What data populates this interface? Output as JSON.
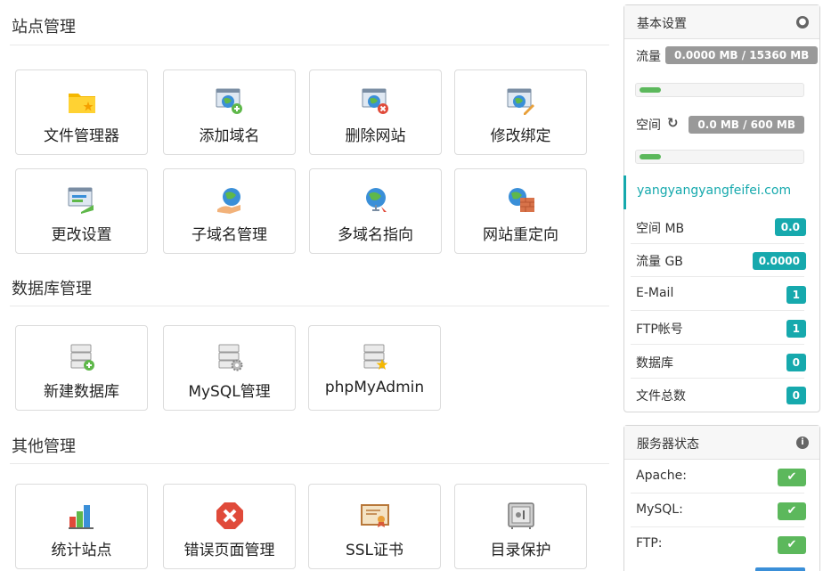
{
  "sections": {
    "site": "站点管理",
    "database": "数据库管理",
    "other": "其他管理"
  },
  "site_tiles": [
    {
      "label": "文件管理器",
      "icon": "folder-star-icon"
    },
    {
      "label": "添加域名",
      "icon": "window-globe-plus-icon"
    },
    {
      "label": "删除网站",
      "icon": "window-globe-delete-icon"
    },
    {
      "label": "修改绑定",
      "icon": "window-globe-edit-icon"
    },
    {
      "label": "更改设置",
      "icon": "window-settings-icon"
    },
    {
      "label": "子域名管理",
      "icon": "globe-hand-icon"
    },
    {
      "label": "多域名指向",
      "icon": "globe-pointer-icon"
    },
    {
      "label": "网站重定向",
      "icon": "globe-wall-icon"
    }
  ],
  "db_tiles": [
    {
      "label": "新建数据库",
      "icon": "database-add-icon"
    },
    {
      "label": "MySQL管理",
      "icon": "database-gear-icon"
    },
    {
      "label": "phpMyAdmin",
      "icon": "database-star-icon"
    }
  ],
  "other_tiles": [
    {
      "label": "统计站点",
      "icon": "bar-chart-icon"
    },
    {
      "label": "错误页面管理",
      "icon": "error-octagon-icon"
    },
    {
      "label": "SSL证书",
      "icon": "certificate-icon"
    },
    {
      "label": "目录保护",
      "icon": "safe-icon"
    }
  ],
  "basic_settings": {
    "title": "基本设置",
    "traffic_label": "流量",
    "traffic_value": "0.0000 MB / 15360 MB",
    "traffic_fraction": 0.0,
    "space_label": "空间",
    "space_value": "0.0 MB / 600 MB",
    "space_fraction": 0.0,
    "domain": "yangyangyangfeifei.com",
    "stats": [
      {
        "label": "空间 MB",
        "value": "0.0"
      },
      {
        "label": "流量 GB",
        "value": "0.0000"
      },
      {
        "label": "E-Mail",
        "value": "1"
      },
      {
        "label": "FTP帐号",
        "value": "1"
      },
      {
        "label": "数据库",
        "value": "0"
      },
      {
        "label": "文件总数",
        "value": "0"
      }
    ]
  },
  "server_status": {
    "title": "服务器状态",
    "services": [
      {
        "label": "Apache:",
        "status": "ok"
      },
      {
        "label": "MySQL:",
        "status": "ok"
      },
      {
        "label": "FTP:",
        "status": "ok"
      }
    ]
  },
  "colors": {
    "teal": "#16a9ad",
    "green": "#5cb85c",
    "gray_badge": "#999999"
  }
}
